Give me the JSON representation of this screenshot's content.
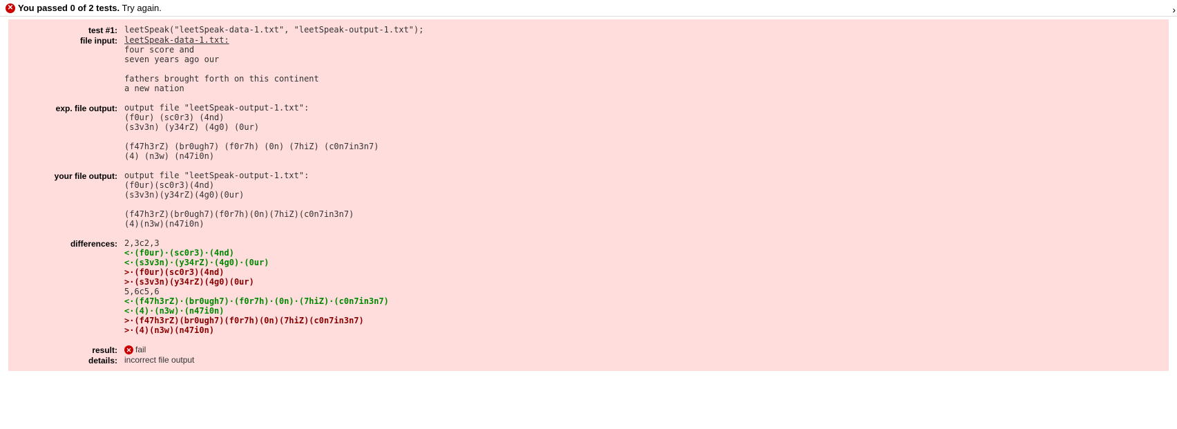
{
  "header": {
    "bold": "You passed 0 of 2 tests.",
    "rest": " Try again."
  },
  "labels": {
    "test": "test #1:",
    "fileInput": "file input:",
    "expOutput": "exp. file output:",
    "yourOutput": "your file output:",
    "differences": "differences:",
    "result": "result:",
    "details": "details:"
  },
  "test1": {
    "call": "leetSpeak(\"leetSpeak-data-1.txt\", \"leetSpeak-output-1.txt\");",
    "fileInputLink": "leetSpeak-data-1.txt:",
    "fileInputLines": [
      "four score and",
      "seven years ago our",
      "",
      "fathers brought forth on this continent",
      "a new nation"
    ],
    "expOutputHeader": "output file \"leetSpeak-output-1.txt\":",
    "expOutputLines": [
      "(f0ur) (sc0r3) (4nd)",
      "(s3v3n) (y34rZ) (4g0) (0ur)",
      "",
      "(f47h3rZ) (br0ugh7) (f0r7h) (0n) (7hiZ) (c0n7in3n7)",
      "(4) (n3w) (n47i0n)"
    ],
    "yourOutputHeader": "output file \"leetSpeak-output-1.txt\":",
    "yourOutputLines": [
      "(f0ur)(sc0r3)(4nd)",
      "(s3v3n)(y34rZ)(4g0)(0ur)",
      "",
      "(f47h3rZ)(br0ugh7)(f0r7h)(0n)(7hiZ)(c0n7in3n7)",
      "(4)(n3w)(n47i0n)"
    ],
    "diffLines": [
      {
        "type": "normal",
        "text": "2,3c2,3"
      },
      {
        "type": "green",
        "text": "<·(f0ur)·(sc0r3)·(4nd)"
      },
      {
        "type": "green",
        "text": "<·(s3v3n)·(y34rZ)·(4g0)·(0ur)"
      },
      {
        "type": "red",
        "text": ">·(f0ur)(sc0r3)(4nd)"
      },
      {
        "type": "red",
        "text": ">·(s3v3n)(y34rZ)(4g0)(0ur)"
      },
      {
        "type": "normal",
        "text": "5,6c5,6"
      },
      {
        "type": "green",
        "text": "<·(f47h3rZ)·(br0ugh7)·(f0r7h)·(0n)·(7hiZ)·(c0n7in3n7)"
      },
      {
        "type": "green",
        "text": "<·(4)·(n3w)·(n47i0n)"
      },
      {
        "type": "red",
        "text": ">·(f47h3rZ)(br0ugh7)(f0r7h)(0n)(7hiZ)(c0n7in3n7)"
      },
      {
        "type": "red",
        "text": ">·(4)(n3w)(n47i0n)"
      }
    ],
    "result": "fail",
    "details": "incorrect file output"
  }
}
